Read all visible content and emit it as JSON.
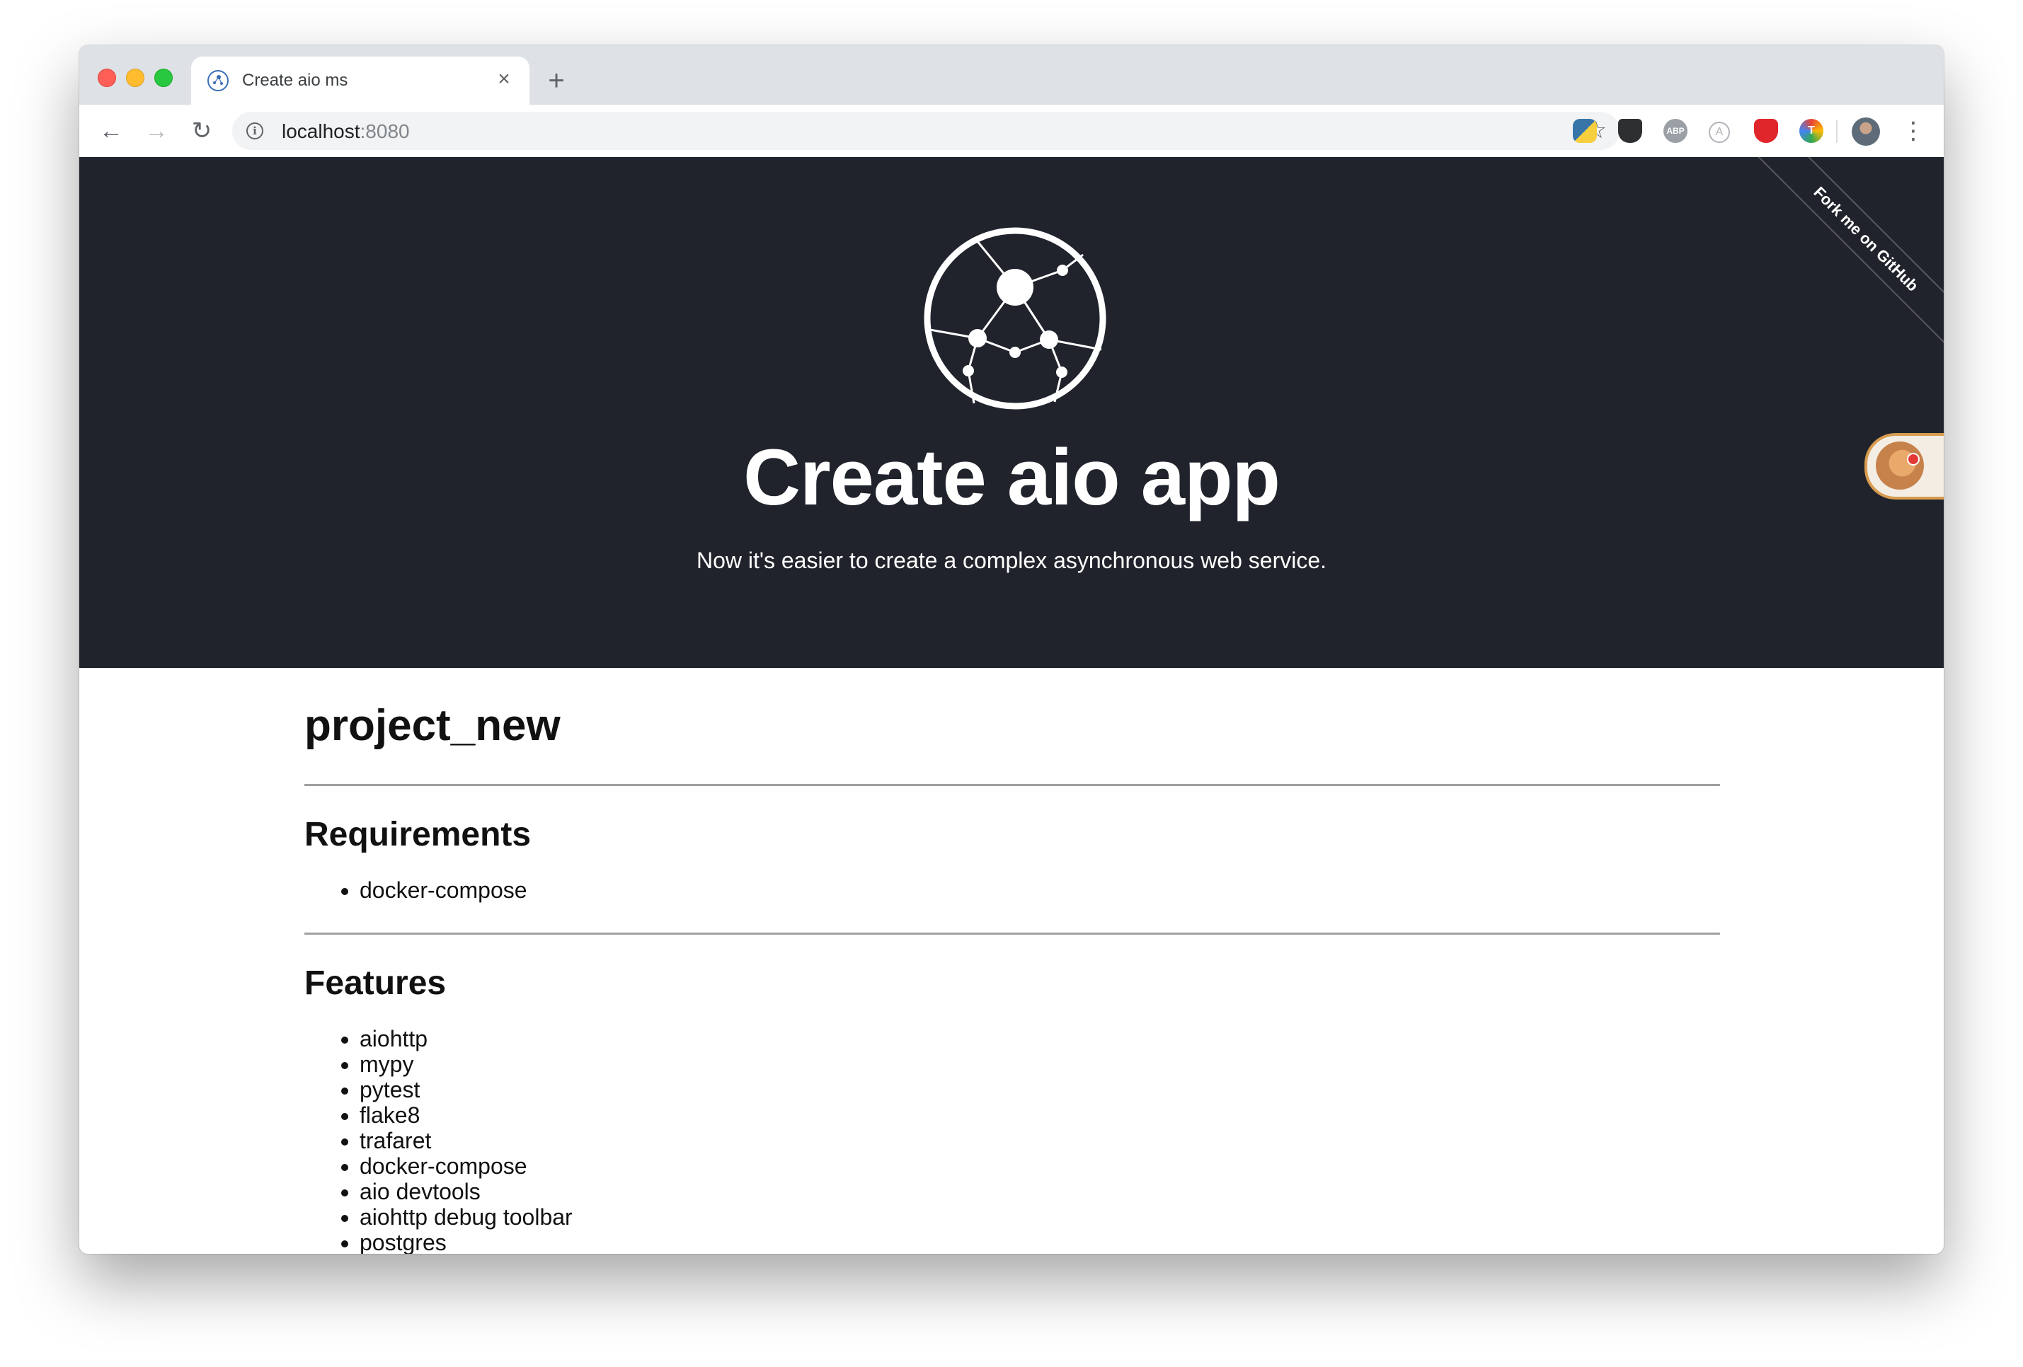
{
  "browser": {
    "tab": {
      "title": "Create aio ms",
      "close_glyph": "×"
    },
    "new_tab_glyph": "+",
    "nav": {
      "back_glyph": "←",
      "forward_glyph": "→",
      "reload_glyph": "↻"
    },
    "address": {
      "host": "localhost",
      "port": ":8080",
      "info_glyph": "i",
      "bookmark_glyph": "☆"
    },
    "extensions": {
      "abp_label": "ABP",
      "a_label": "A",
      "t_label": "T",
      "icons": [
        "python-icon",
        "pocket-icon",
        "adblock-plus-icon",
        "a-extension-icon",
        "ublock-icon",
        "t-extension-icon"
      ]
    },
    "menu_glyph": "⋮"
  },
  "hero": {
    "title": "Create aio app",
    "subtitle": "Now it's easier to create a complex asynchronous web service.",
    "ribbon": "Fork me on GitHub",
    "background_color": "#20232b"
  },
  "content": {
    "project_title": "project_new",
    "requirements": {
      "heading": "Requirements",
      "items": [
        "docker-compose"
      ]
    },
    "features": {
      "heading": "Features",
      "items": [
        "aiohttp",
        "mypy",
        "pytest",
        "flake8",
        "trafaret",
        "docker-compose",
        "aio devtools",
        "aiohttp debug toolbar",
        "postgres"
      ]
    }
  }
}
